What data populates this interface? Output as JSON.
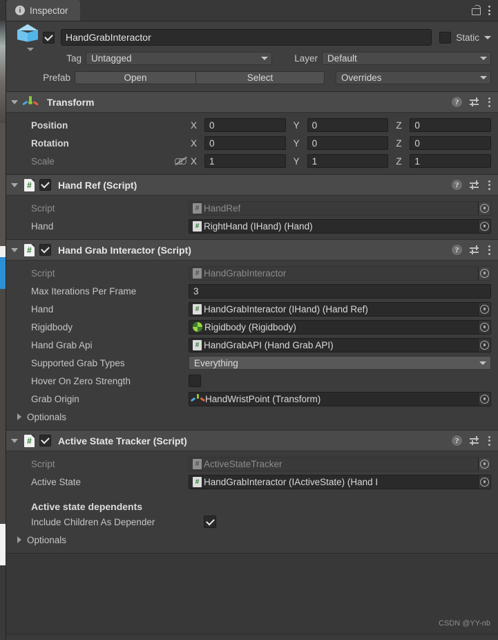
{
  "window": {
    "tab_label": "Inspector",
    "tab_icon": "info-icon",
    "lock_icon": "lock-open-icon",
    "menu_icon": "kebab-menu-icon"
  },
  "gameobject": {
    "icon": "prefab-cube-icon",
    "enabled": true,
    "name": "HandGrabInteractor",
    "static_label": "Static",
    "static_checked": false,
    "tag_label": "Tag",
    "tag_value": "Untagged",
    "layer_label": "Layer",
    "layer_value": "Default",
    "prefab_label": "Prefab",
    "open_label": "Open",
    "select_label": "Select",
    "overrides_label": "Overrides"
  },
  "components": [
    {
      "title": "Transform",
      "icon": "transform-axis-icon",
      "expanded": true,
      "has_enable_checkbox": false,
      "enabled": true,
      "rows": [
        {
          "type": "vector3",
          "label": "Position",
          "axes": [
            "X",
            "Y",
            "Z"
          ],
          "values": [
            "0",
            "0",
            "0"
          ],
          "link": false
        },
        {
          "type": "vector3",
          "label": "Rotation",
          "axes": [
            "X",
            "Y",
            "Z"
          ],
          "values": [
            "0",
            "0",
            "0"
          ],
          "link": false
        },
        {
          "type": "vector3",
          "label": "Scale",
          "dim": true,
          "axes": [
            "X",
            "Y",
            "Z"
          ],
          "values": [
            "1",
            "1",
            "1"
          ],
          "link": true,
          "link_icon": "broken-link-icon"
        }
      ]
    },
    {
      "title": "Hand Ref (Script)",
      "icon": "script-icon",
      "expanded": true,
      "has_enable_checkbox": true,
      "enabled": true,
      "rows": [
        {
          "type": "object",
          "label": "Script",
          "dim": true,
          "value": "HandRef",
          "value_icon": "script-file-icon",
          "disabled": true
        },
        {
          "type": "object",
          "label": "Hand",
          "value": "RightHand (IHand) (Hand)",
          "value_icon": "script-file-icon",
          "disabled": false
        }
      ]
    },
    {
      "title": "Hand Grab Interactor (Script)",
      "icon": "script-icon",
      "expanded": true,
      "has_enable_checkbox": true,
      "enabled": true,
      "rows": [
        {
          "type": "object",
          "label": "Script",
          "dim": true,
          "value": "HandGrabInteractor",
          "value_icon": "script-file-icon",
          "disabled": true
        },
        {
          "type": "number",
          "label": "Max Iterations Per Frame",
          "value": "3"
        },
        {
          "type": "object",
          "label": "Hand",
          "value": "HandGrabInteractor (IHand) (Hand Ref)",
          "value_icon": "script-file-icon",
          "disabled": false
        },
        {
          "type": "object",
          "label": "Rigidbody",
          "value": "Rigidbody (Rigidbody)",
          "value_icon": "rigidbody-icon",
          "disabled": false
        },
        {
          "type": "object",
          "label": "Hand Grab Api",
          "value": "HandGrabAPI (Hand Grab API)",
          "value_icon": "script-file-icon",
          "disabled": false
        },
        {
          "type": "dropdown",
          "label": "Supported Grab Types",
          "value": "Everything"
        },
        {
          "type": "checkbox",
          "label": "Hover On Zero Strength",
          "checked": false
        },
        {
          "type": "object",
          "label": "Grab Origin",
          "value": "HandWristPoint (Transform)",
          "value_icon": "transform-axis-icon",
          "disabled": false
        },
        {
          "type": "foldout",
          "label": "Optionals",
          "expanded": false
        }
      ]
    },
    {
      "title": "Active State Tracker (Script)",
      "icon": "script-icon",
      "expanded": true,
      "has_enable_checkbox": true,
      "enabled": true,
      "rows": [
        {
          "type": "object",
          "label": "Script",
          "dim": true,
          "value": "ActiveStateTracker",
          "value_icon": "script-file-icon",
          "disabled": true
        },
        {
          "type": "object",
          "label": "Active State",
          "value": "HandGrabInteractor (IActiveState) (Hand I",
          "value_icon": "script-file-icon",
          "disabled": false
        },
        {
          "type": "spacer"
        },
        {
          "type": "header",
          "label": "Active state dependents"
        },
        {
          "type": "checkbox",
          "label": "Include Children As Depender",
          "checked": true
        },
        {
          "type": "foldout",
          "label": "Optionals",
          "expanded": false
        }
      ]
    }
  ],
  "watermark": "CSDN @YY-nb"
}
